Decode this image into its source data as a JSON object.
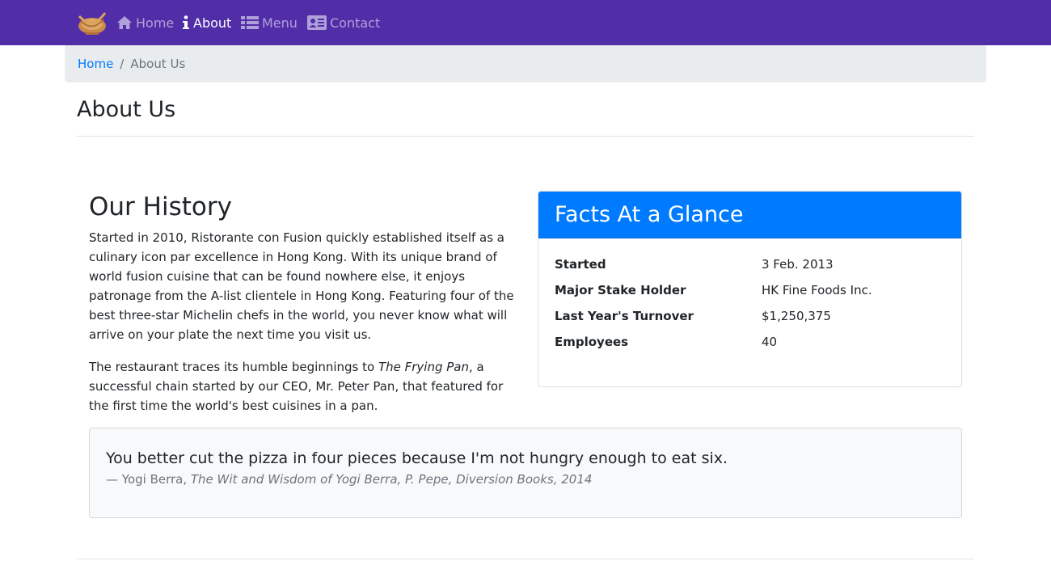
{
  "navbar": {
    "brand_icon": "restaurant-logo",
    "background": "#512da8",
    "links": [
      {
        "label": "Home",
        "icon": "home-icon",
        "active": false
      },
      {
        "label": "About",
        "icon": "info-icon",
        "active": true
      },
      {
        "label": "Menu",
        "icon": "list-icon",
        "active": false
      },
      {
        "label": "Contact",
        "icon": "address-card-icon",
        "active": false
      }
    ]
  },
  "breadcrumb": {
    "home": "Home",
    "separator": "/",
    "current": "About Us"
  },
  "page": {
    "title": "About Us"
  },
  "history": {
    "title": "Our History",
    "p1": "Started in 2010, Ristorante con Fusion quickly established itself as a culinary icon par excellence in Hong Kong. With its unique brand of world fusion cuisine that can be found nowhere else, it enjoys patronage from the A-list clientele in Hong Kong. Featuring four of the best three-star Michelin chefs in the world, you never know what will arrive on your plate the next time you visit us.",
    "p2_before": "The restaurant traces its humble beginnings to ",
    "p2_em": "The Frying Pan",
    "p2_after": ", a successful chain started by our CEO, Mr. Peter Pan, that featured for the first time the world's best cuisines in a pan."
  },
  "facts": {
    "title": "Facts At a Glance",
    "header_color": "#007bff",
    "rows": [
      {
        "label": "Started",
        "value": "3 Feb. 2013"
      },
      {
        "label": "Major Stake Holder",
        "value": "HK Fine Foods Inc."
      },
      {
        "label": "Last Year's Turnover",
        "value": "$1,250,375"
      },
      {
        "label": "Employees",
        "value": "40"
      }
    ]
  },
  "quote": {
    "text": "You better cut the pizza in four pieces because I'm not hungry enough to eat six.",
    "author": "— Yogi Berra, ",
    "source": "The Wit and Wisdom of Yogi Berra, P. Pepe, Diversion Books, 2014"
  }
}
